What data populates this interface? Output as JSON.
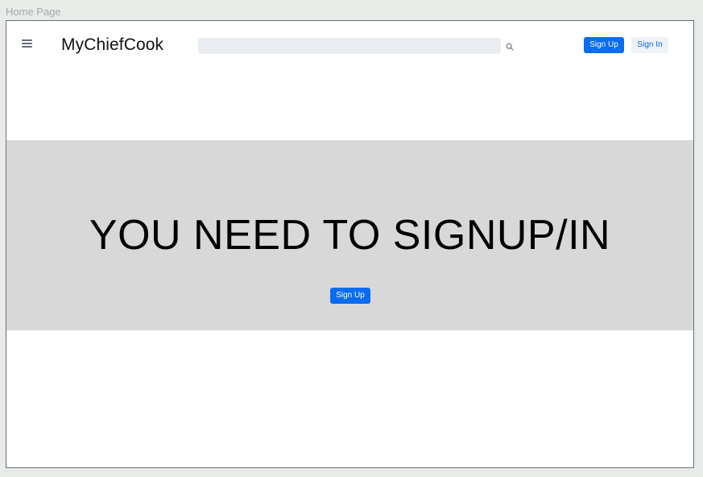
{
  "frame": {
    "label": "Home Page"
  },
  "header": {
    "brand": "MyChiefCook",
    "search": {
      "value": "",
      "placeholder": ""
    },
    "signup_label": "Sign Up",
    "signin_label": "Sign In"
  },
  "hero": {
    "title": "YOU NEED TO SIGNUP/IN",
    "signup_label": "Sign Up"
  },
  "icons": {
    "menu": "hamburger-menu-icon",
    "search": "search-icon"
  },
  "colors": {
    "primary": "#0a6cf0",
    "secondary_bg": "#eef2f7",
    "hero_bg": "#d9d8d8",
    "search_bg": "#e9ecf0",
    "canvas_bg": "#e8ece9"
  }
}
